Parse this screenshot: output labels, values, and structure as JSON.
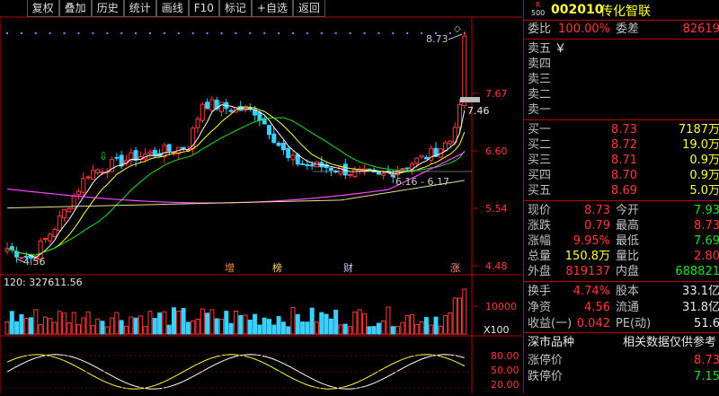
{
  "toolbar": {
    "buttons": [
      "复权",
      "叠加",
      "历史",
      "统计",
      "画线",
      "F10",
      "标记",
      "+自选",
      "返回"
    ]
  },
  "main_chart": {
    "price_axis": [
      "7.67",
      "6.60",
      "5.54",
      "4.48"
    ],
    "high_label": "8.73",
    "low_label": "4.56",
    "range_label": "6.16 - 6.17",
    "marker_price": "7.46",
    "events": [
      "增",
      "榜",
      "财",
      "涨"
    ]
  },
  "volume_chart": {
    "ma_label": "120: 327611.56",
    "axis": [
      "10000",
      "X100"
    ]
  },
  "oscillator": {
    "axis": [
      "80.00",
      "50.00",
      "20.00"
    ]
  },
  "stock": {
    "header_mark": "R\n500",
    "code": "002010",
    "name": "传化智联"
  },
  "quote": {
    "committee_ratio_label": "委比",
    "committee_ratio": "100.00%",
    "committee_diff_label": "委差",
    "committee_diff": "82619",
    "asks": [
      {
        "label": "卖五",
        "price": "",
        "vol": "",
        "mark": "￥"
      },
      {
        "label": "卖四",
        "price": "",
        "vol": "",
        "mark": ""
      },
      {
        "label": "卖三",
        "price": "",
        "vol": "",
        "mark": ""
      },
      {
        "label": "卖二",
        "price": "",
        "vol": "",
        "mark": ""
      },
      {
        "label": "卖一",
        "price": "",
        "vol": "",
        "mark": ""
      }
    ],
    "bids": [
      {
        "label": "买一",
        "price": "8.73",
        "vol": "7187万"
      },
      {
        "label": "买二",
        "price": "8.72",
        "vol": "19.0万"
      },
      {
        "label": "买三",
        "price": "8.71",
        "vol": "0.9万"
      },
      {
        "label": "买四",
        "price": "8.70",
        "vol": "0.9万"
      },
      {
        "label": "买五",
        "price": "8.69",
        "vol": "5.0万"
      }
    ],
    "stats": [
      {
        "l1": "现价",
        "v1": "8.73",
        "l2": "今开",
        "v2": "7.93"
      },
      {
        "l1": "涨跌",
        "v1": "0.79",
        "l2": "最高",
        "v2": "8.73"
      },
      {
        "l1": "涨幅",
        "v1": "9.95%",
        "l2": "最低",
        "v2": "7.69"
      },
      {
        "l1": "总量",
        "v1": "150.8万",
        "l2": "量比",
        "v2": "2.80"
      },
      {
        "l1": "外盘",
        "v1": "819137",
        "l2": "内盘",
        "v2": "688821"
      }
    ],
    "fund": [
      {
        "l1": "换手",
        "v1": "4.74%",
        "l2": "股本",
        "v2": "33.1亿"
      },
      {
        "l1": "净资",
        "v1": "4.56",
        "l2": "流通",
        "v2": "31.8亿"
      },
      {
        "l1": "收益(一)",
        "v1": "0.042",
        "l2": "PE(动)",
        "v2": "51.6"
      }
    ],
    "section_left": "深市品种",
    "section_right": "相关数据仅供参考",
    "limit_up_label": "涨停价",
    "limit_up": "8.73",
    "limit_down_label": "跌停价",
    "limit_down": "7.15"
  },
  "colors": {
    "up": "#ff3a3a",
    "down": "#3ad0ff",
    "ma5": "#ffffff",
    "ma10": "#ffff3a",
    "ma20": "#22e022",
    "ma60": "#ff44ff",
    "border": "#b00000"
  }
}
